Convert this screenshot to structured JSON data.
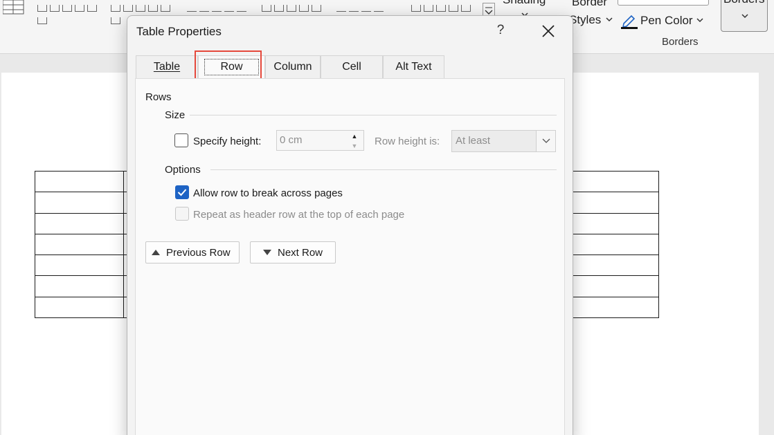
{
  "ribbon": {
    "shading_label": "Shading",
    "border_styles_line1": "Border",
    "border_styles_line2": "Styles",
    "pen_color_label": "Pen Color",
    "borders_label": "Borders",
    "group_label": "Borders"
  },
  "dialog": {
    "title": "Table Properties",
    "help_label": "?",
    "tabs": [
      {
        "label": "Table"
      },
      {
        "label": "Row"
      },
      {
        "label": "Column"
      },
      {
        "label": "Cell"
      },
      {
        "label": "Alt Text"
      }
    ],
    "active_tab": "Row",
    "rows_heading": "Rows",
    "size": {
      "heading": "Size",
      "specify_height_label": "Specify height:",
      "specify_height_checked": false,
      "height_value": "0 cm",
      "row_height_is_label": "Row height is:",
      "row_height_is_value": "At least"
    },
    "options": {
      "heading": "Options",
      "allow_break_label": "Allow row to break across pages",
      "allow_break_checked": true,
      "repeat_header_label": "Repeat as header row at the top of each page",
      "repeat_header_checked": false
    },
    "previous_row_label": "Previous Row",
    "next_row_label": "Next Row"
  },
  "colors": {
    "accent": "#1e63c4",
    "highlight": "#e5483b"
  }
}
